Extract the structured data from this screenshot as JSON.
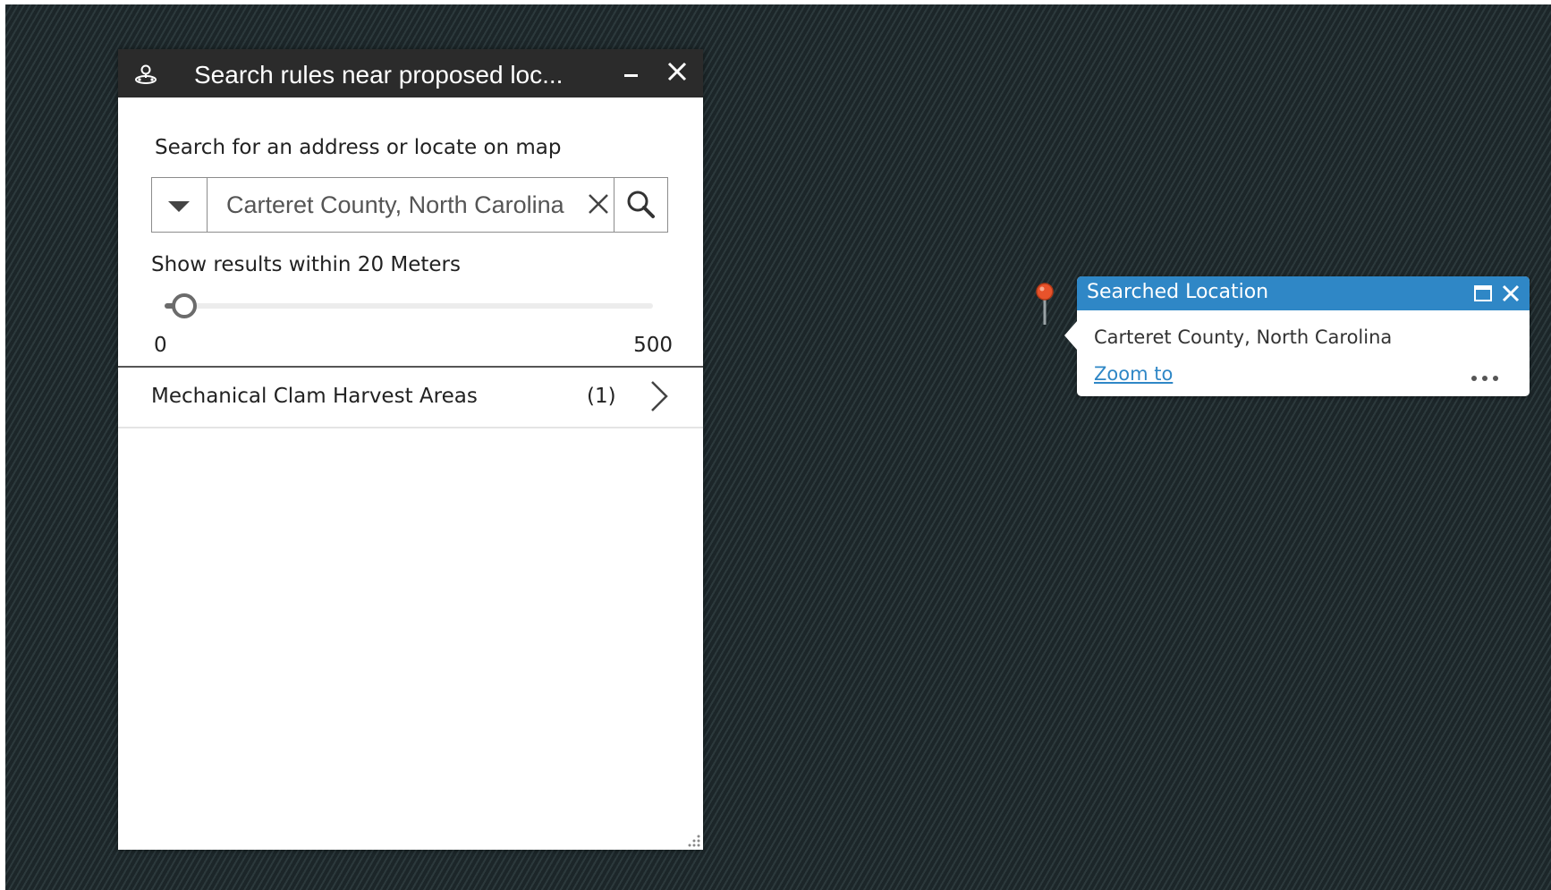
{
  "widget": {
    "title": "Search rules near proposed loc...",
    "header_icon": "location-search-icon",
    "minimize_icon": "minimize-icon",
    "close_icon": "close-icon",
    "search_label": "Search for an address or locate on map",
    "search": {
      "value": "Carteret County, North Carolina",
      "dropdown_icon": "caret-down-icon",
      "clear_icon": "clear-icon",
      "search_icon": "search-icon"
    },
    "distance_label": "Show results within 20 Meters",
    "slider": {
      "min": "0",
      "max": "500",
      "value": 20
    },
    "results": [
      {
        "name": "Mechanical Clam Harvest Areas",
        "count": "(1)",
        "icon": "chevron-right-icon"
      }
    ]
  },
  "popup": {
    "title": "Searched Location",
    "content": "Carteret County, North Carolina",
    "zoom_label": "Zoom to",
    "maximize_icon": "maximize-icon",
    "close_icon": "close-icon",
    "more_icon": "more-icon"
  },
  "colors": {
    "panel_header": "#2b2b2b",
    "popup_header": "#2f87c6",
    "map_background": "#1e2a2d",
    "pin": "#e8532b"
  }
}
